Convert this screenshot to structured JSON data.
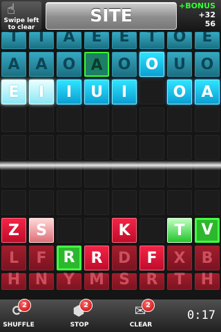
{
  "header": {
    "hint": "Swipe left\nto clear",
    "current_word": "SITE",
    "bonus_label": "+BONUS",
    "bonus_points": "+32",
    "total_score": "56"
  },
  "board": {
    "rows": [
      [
        "T",
        "I",
        "A",
        "E",
        "E",
        "T",
        "O",
        "E"
      ],
      [
        "A",
        "A",
        "O",
        "A",
        "O",
        "O",
        "U",
        "O"
      ],
      [
        "E",
        "I",
        "I",
        "U",
        "I",
        "",
        "O",
        "A"
      ],
      [
        "",
        "",
        "",
        "",
        "",
        "",
        "",
        ""
      ],
      [
        "",
        "",
        "",
        "",
        "",
        "",
        "",
        ""
      ],
      [
        "",
        "",
        "",
        "",
        "",
        "",
        "",
        ""
      ],
      [
        "",
        "",
        "",
        "",
        "",
        "",
        "",
        ""
      ],
      [
        "Z",
        "S",
        "",
        "",
        "K",
        "",
        "T",
        "V"
      ],
      [
        "L",
        "F",
        "R",
        "R",
        "D",
        "F",
        "X",
        "B"
      ],
      [
        "H",
        "N",
        "Y",
        "M",
        "S",
        "R",
        "T",
        "H"
      ]
    ],
    "styles": [
      [
        "blue",
        "blue",
        "blue",
        "blue",
        "blue",
        "blue",
        "blue",
        "blue"
      ],
      [
        "blue",
        "blue",
        "blue",
        "green-blue",
        "blue",
        "cyan",
        "blue",
        "blue"
      ],
      [
        "white",
        "white",
        "cyan",
        "cyan",
        "cyan",
        "grid",
        "cyan",
        "cyan"
      ],
      [
        "grid",
        "grid",
        "grid",
        "grid",
        "grid",
        "grid",
        "grid",
        "grid"
      ],
      [
        "grid",
        "grid",
        "grid",
        "grid",
        "grid",
        "grid",
        "grid",
        "grid"
      ],
      [
        "grid",
        "grid",
        "grid",
        "grid",
        "grid",
        "grid",
        "grid",
        "grid"
      ],
      [
        "grid",
        "grid",
        "grid",
        "grid",
        "grid",
        "grid",
        "grid",
        "grid"
      ],
      [
        "redb",
        "pink",
        "grid",
        "grid",
        "redb",
        "grid",
        "lgreen",
        "dgreen"
      ],
      [
        "red",
        "red",
        "dgreen",
        "redb",
        "red",
        "redb",
        "red",
        "red"
      ],
      [
        "red",
        "red",
        "red",
        "red",
        "red",
        "red",
        "red",
        "red"
      ]
    ]
  },
  "footer": {
    "buttons": [
      {
        "label": "SHUFFLE",
        "badge": "2",
        "icon": "shuffle-icon",
        "glyph": "⟳"
      },
      {
        "label": "STOP",
        "badge": "2",
        "icon": "stop-icon",
        "glyph": "⬢"
      },
      {
        "label": "CLEAR",
        "badge": "2",
        "icon": "clear-icon",
        "glyph": "✉"
      }
    ],
    "timer": "0:17"
  }
}
